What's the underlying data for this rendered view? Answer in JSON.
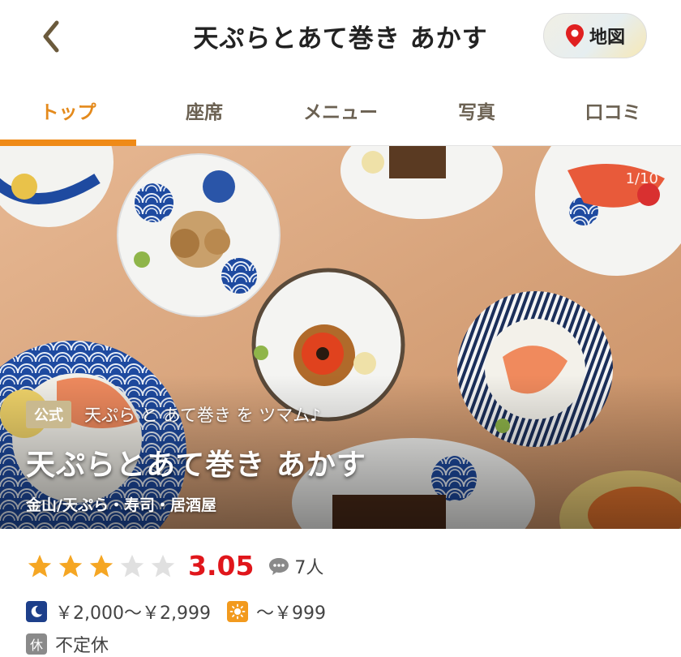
{
  "header": {
    "title": "天ぷらとあて巻き あかす",
    "map_label": "地図"
  },
  "tabs": [
    {
      "label": "トップ",
      "active": true
    },
    {
      "label": "座席",
      "active": false
    },
    {
      "label": "メニュー",
      "active": false
    },
    {
      "label": "写真",
      "active": false
    },
    {
      "label": "口コミ",
      "active": false
    }
  ],
  "hero": {
    "counter": "1/10",
    "badge": "公式",
    "catchphrase": "天ぷら と あて巻き を ツマム♪",
    "name": "天ぷらとあて巻き あかす",
    "area_genre": "金山/天ぷら・寿司・居酒屋"
  },
  "rating": {
    "stars_filled": 3,
    "stars_total": 5,
    "score": "3.05",
    "review_count": "7人"
  },
  "price": {
    "dinner": "￥2,000～￥2,999",
    "lunch": "～￥999"
  },
  "holiday": {
    "icon_text": "休",
    "text": "不定休"
  },
  "colors": {
    "accent": "#ef8a17",
    "score": "#e0161b",
    "star": "#f5a623",
    "star_empty": "#e0e0e0",
    "dinner_icon": "#1d3f8a",
    "lunch_icon": "#f29a1e"
  }
}
